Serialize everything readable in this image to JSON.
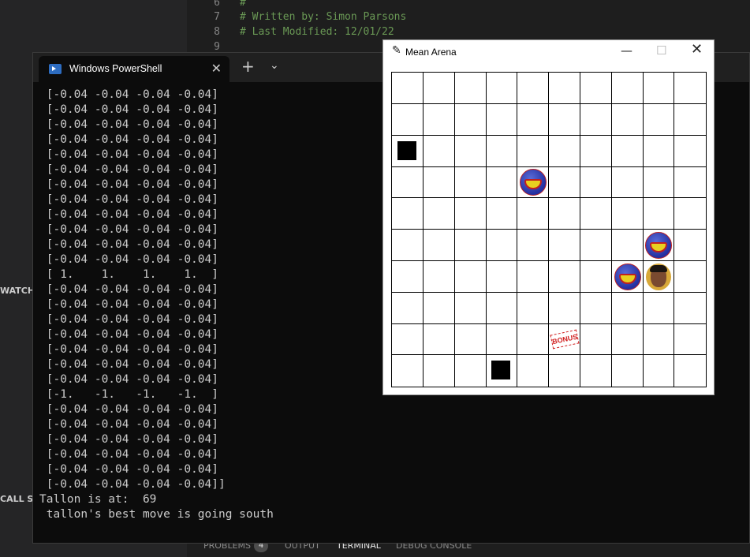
{
  "editor": {
    "lines": [
      {
        "num": "6",
        "text": "#"
      },
      {
        "num": "7",
        "text": "# Written by: Simon Parsons"
      },
      {
        "num": "8",
        "text": "# Last Modified: 12/01/22"
      },
      {
        "num": "9",
        "text": ""
      }
    ]
  },
  "sidebar": {
    "watch_label": "WATCH",
    "callstack_label": "CALL ST"
  },
  "panel_tabs": {
    "problems": "PROBLEMS",
    "problems_count": "4",
    "output": "OUTPUT",
    "terminal": "TERMINAL",
    "debug_console": "DEBUG CONSOLE"
  },
  "powershell": {
    "tab_title": "Windows PowerShell",
    "close_glyph": "✕",
    "new_tab_glyph": "+",
    "dropdown_glyph": "⌄",
    "lines": [
      " [-0.04 -0.04 -0.04 -0.04]",
      " [-0.04 -0.04 -0.04 -0.04]",
      " [-0.04 -0.04 -0.04 -0.04]",
      " [-0.04 -0.04 -0.04 -0.04]",
      " [-0.04 -0.04 -0.04 -0.04]",
      " [-0.04 -0.04 -0.04 -0.04]",
      " [-0.04 -0.04 -0.04 -0.04]",
      " [-0.04 -0.04 -0.04 -0.04]",
      " [-0.04 -0.04 -0.04 -0.04]",
      " [-0.04 -0.04 -0.04 -0.04]",
      " [-0.04 -0.04 -0.04 -0.04]",
      " [-0.04 -0.04 -0.04 -0.04]",
      " [ 1.    1.    1.    1.  ]",
      " [-0.04 -0.04 -0.04 -0.04]",
      " [-0.04 -0.04 -0.04 -0.04]",
      " [-0.04 -0.04 -0.04 -0.04]",
      " [-0.04 -0.04 -0.04 -0.04]",
      " [-0.04 -0.04 -0.04 -0.04]",
      " [-0.04 -0.04 -0.04 -0.04]",
      " [-0.04 -0.04 -0.04 -0.04]",
      " [-1.   -1.   -1.   -1.  ]",
      " [-0.04 -0.04 -0.04 -0.04]",
      " [-0.04 -0.04 -0.04 -0.04]",
      " [-0.04 -0.04 -0.04 -0.04]",
      " [-0.04 -0.04 -0.04 -0.04]",
      " [-0.04 -0.04 -0.04 -0.04]",
      " [-0.04 -0.04 -0.04 -0.04]]",
      "Tallon is at:  69",
      " tallon's best move is going south"
    ]
  },
  "arena": {
    "title": "Mean Arena",
    "min_glyph": "—",
    "max_glyph": "☐",
    "close_glyph": "✕",
    "grid_cols": 10,
    "grid_rows": 10,
    "pits": [
      {
        "col": 0,
        "row": 2
      },
      {
        "col": 3,
        "row": 9
      }
    ],
    "meanies": [
      {
        "col": 4,
        "row": 3
      },
      {
        "col": 8,
        "row": 5
      },
      {
        "col": 7,
        "row": 6
      }
    ],
    "tallon": {
      "col": 8,
      "row": 6
    },
    "bonuses": [
      {
        "col": 5,
        "row": 8,
        "label": "BONUS"
      }
    ]
  }
}
